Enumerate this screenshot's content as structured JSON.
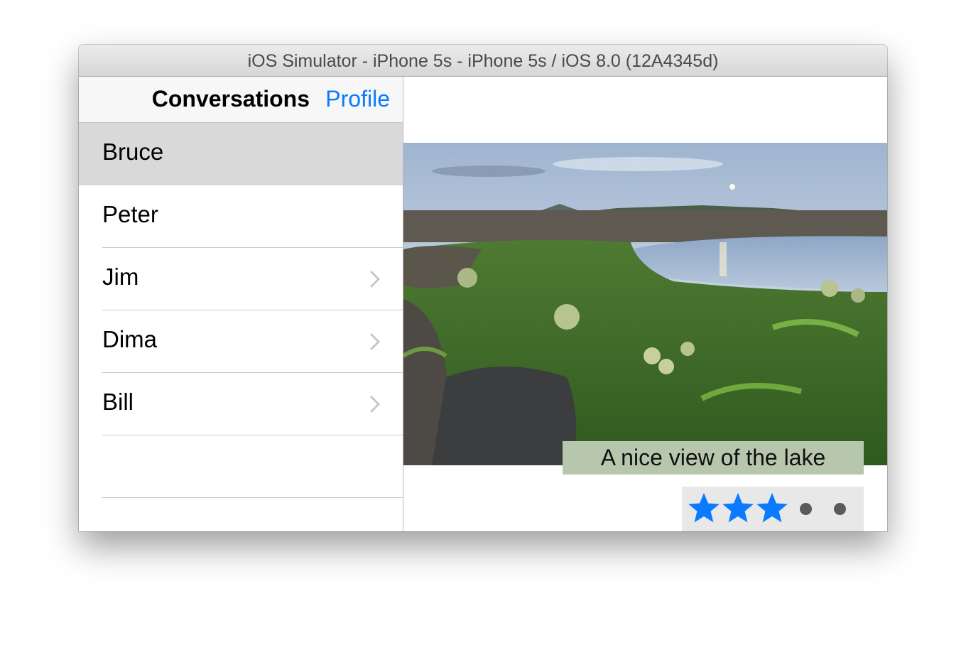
{
  "window": {
    "title": "iOS Simulator - iPhone 5s - iPhone 5s / iOS 8.0 (12A4345d)"
  },
  "master": {
    "nav_title": "Conversations",
    "profile_button": "Profile",
    "rows": [
      {
        "name": "Bruce",
        "selected": true,
        "chevron": false
      },
      {
        "name": "Peter",
        "selected": false,
        "chevron": false
      },
      {
        "name": "Jim",
        "selected": false,
        "chevron": true
      },
      {
        "name": "Dima",
        "selected": false,
        "chevron": true
      },
      {
        "name": "Bill",
        "selected": false,
        "chevron": true
      },
      {
        "name": "",
        "selected": false,
        "chevron": false
      }
    ]
  },
  "detail": {
    "photo": "lake-landscape-photo",
    "caption": "A nice view of the lake",
    "rating": {
      "value": 3,
      "max": 5,
      "filled_color": "#0a7aff",
      "empty_color": "#5a5a5a"
    }
  },
  "colors": {
    "accent": "#0a7aff",
    "selected_row": "#d9d9d9",
    "caption_bg": "#b7c7ad"
  }
}
